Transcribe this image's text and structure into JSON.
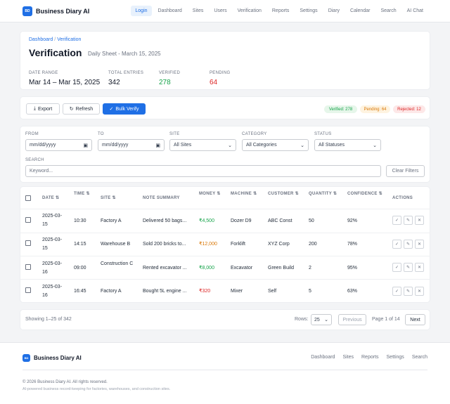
{
  "app": {
    "name": "Business Diary AI",
    "logo_text": "BD"
  },
  "nav": {
    "items": [
      "Login",
      "Dashboard",
      "Sites",
      "Users",
      "Verification",
      "Reports",
      "Settings",
      "Diary",
      "Calendar",
      "Search",
      "AI Chat"
    ],
    "active": "Login"
  },
  "breadcrumb": {
    "items": [
      "Dashboard",
      "Verification"
    ],
    "separator": "/"
  },
  "page": {
    "title": "Verification",
    "subtitle": "Daily Sheet - March 15, 2025"
  },
  "stats": [
    {
      "label": "DATE RANGE",
      "value": "Mar 14 – Mar 15, 2025",
      "color": "#111827"
    },
    {
      "label": "TOTAL ENTRIES",
      "value": "342",
      "color": "#111827"
    },
    {
      "label": "VERIFIED",
      "value": "278",
      "color": "#16a34a"
    },
    {
      "label": "PENDING",
      "value": "64",
      "color": "#dc2626"
    }
  ],
  "toolbar": {
    "export_label": "Export",
    "refresh_label": "Refresh",
    "bulk_label": "Bulk Verify"
  },
  "badges": {
    "verified": "Verified: 278",
    "pending": "Pending: 64",
    "rejected": "Rejected: 12"
  },
  "filters": {
    "from_label": "FROM",
    "from_placeholder": "mm/dd/yyyy",
    "to_label": "TO",
    "to_placeholder": "mm/dd/yyyy",
    "site_label": "SITE",
    "site_value": "All Sites",
    "category_label": "CATEGORY",
    "category_value": "All Categories",
    "status_label": "STATUS",
    "status_value": "All Statuses",
    "search_label": "SEARCH",
    "search_placeholder": "Keyword...",
    "clear_label": "Clear Filters"
  },
  "table": {
    "columns": [
      "DATE ⇅",
      "TIME ⇅",
      "SITE ⇅",
      "NOTE SUMMARY",
      "MONEY ⇅",
      "MACHINE ⇅",
      "CUSTOMER ⇅",
      "QUANTITY ⇅",
      "CONFIDENCE ⇅",
      "ACTIONS"
    ],
    "rows": [
      {
        "date": "2025-03-15",
        "time": "10:30",
        "site": "Factory A",
        "note": "Delivered 50 bags...",
        "money": "₹4,500",
        "money_color": "#16a34a",
        "machine": "Dozer D9",
        "customer": "ABC Const",
        "quantity": "50",
        "confidence": "92%"
      },
      {
        "date": "2025-03-15",
        "time": "14:15",
        "site": "Warehouse B",
        "note": "Sold 200 bricks to...",
        "money": "₹12,000",
        "money_color": "#d97706",
        "machine": "Forklift",
        "customer": "XYZ Corp",
        "quantity": "200",
        "confidence": "78%"
      },
      {
        "date": "2025-03-16",
        "time": "09:00",
        "site": "Construction C",
        "note": "Rented excavator ...",
        "money": "₹8,000",
        "money_color": "#16a34a",
        "machine": "Excavator",
        "customer": "Green Build",
        "quantity": "2",
        "confidence": "95%"
      },
      {
        "date": "2025-03-16",
        "time": "16:45",
        "site": "Factory A",
        "note": "Bought 5L engine ...",
        "money": "₹320",
        "money_color": "#dc2626",
        "machine": "Mixer",
        "customer": "Self",
        "quantity": "5",
        "confidence": "63%"
      }
    ],
    "action_icons": [
      "check-icon",
      "edit-icon",
      "close-icon"
    ],
    "action_glyphs": [
      "✓",
      "✎",
      "✕"
    ]
  },
  "pagination": {
    "showing": "Showing 1–25 of 342",
    "rows_label": "Rows:",
    "rows_value": "25",
    "prev_label": "Previous",
    "page_text": "Page 1 of 14",
    "next_label": "Next"
  },
  "footer": {
    "brand": "Business Diary AI",
    "links": [
      "Dashboard",
      "Sites",
      "Reports",
      "Settings",
      "Search"
    ],
    "copyright": "© 2026 Business Diary AI. All rights reserved.",
    "tagline": "AI-powered business record-keeping for factories, warehouses, and construction sites."
  },
  "colors": {
    "accent": "#1f6fe5",
    "success": "#16a34a",
    "warning": "#d97706",
    "danger": "#dc2626"
  }
}
